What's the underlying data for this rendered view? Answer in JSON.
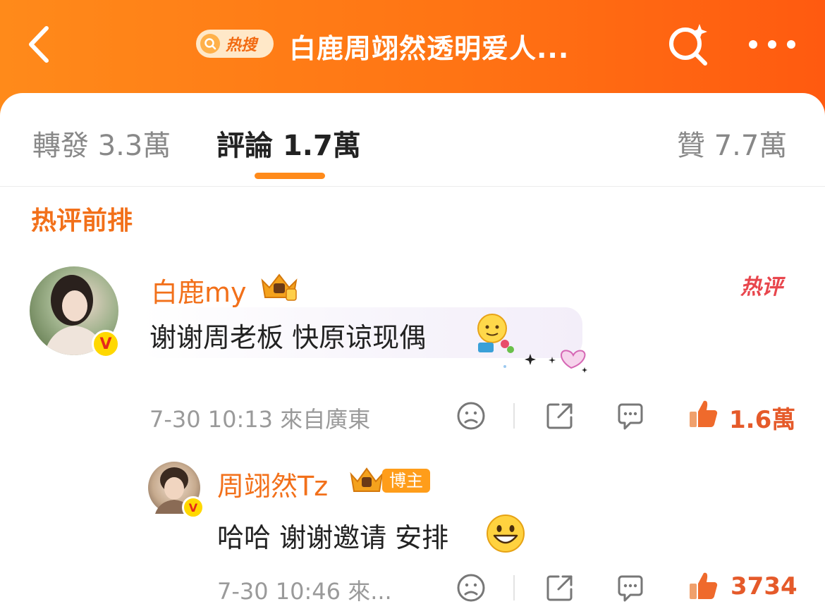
{
  "topbar": {
    "hot_search_label": "热搜",
    "title": "白鹿周翊然透明爱人...",
    "back_icon": "chevron-left-icon",
    "search_icon": "sparkle-search-icon",
    "more_icon": "more-dots-icon",
    "colors": {
      "gradient_start": "#ff8a1a",
      "gradient_end": "#ff5a10"
    }
  },
  "tabs": [
    {
      "label": "轉發",
      "count": "3.3萬",
      "active": false
    },
    {
      "label": "評論",
      "count": "1.7萬",
      "active": true
    },
    {
      "label": "贊",
      "count": "7.7萬",
      "active": false
    }
  ],
  "section": {
    "title": "热评前排"
  },
  "comment": {
    "user": "白鹿my",
    "verified": true,
    "hot_tag": "热评",
    "text": "谢谢周老板 快原谅现偶",
    "meta": "7-30 10:13 來自廣東",
    "likes": "1.6萬",
    "icons": [
      "sad-face-icon",
      "share-icon",
      "comment-icon",
      "thumbs-up-icon"
    ]
  },
  "reply": {
    "user": "周翊然Tz",
    "verified": true,
    "badge": "博主",
    "text": "哈哈 谢谢邀请 安排",
    "meta": "7-30 10:46 來...",
    "likes": "3734"
  },
  "colors": {
    "accent": "#f2701a",
    "like": "#e55a2a",
    "hot_tag": "#e8464d"
  }
}
